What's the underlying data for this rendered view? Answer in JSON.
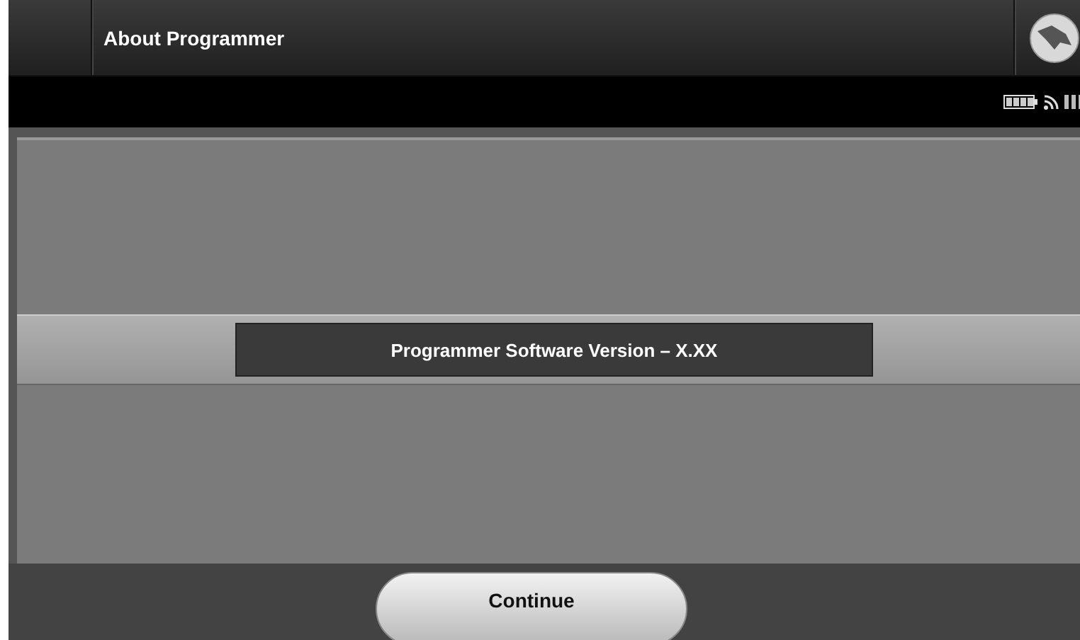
{
  "header": {
    "title": "About Programmer"
  },
  "version_bar": {
    "text": "Programmer Software Version – X.XX"
  },
  "footer": {
    "button": "Continue"
  }
}
